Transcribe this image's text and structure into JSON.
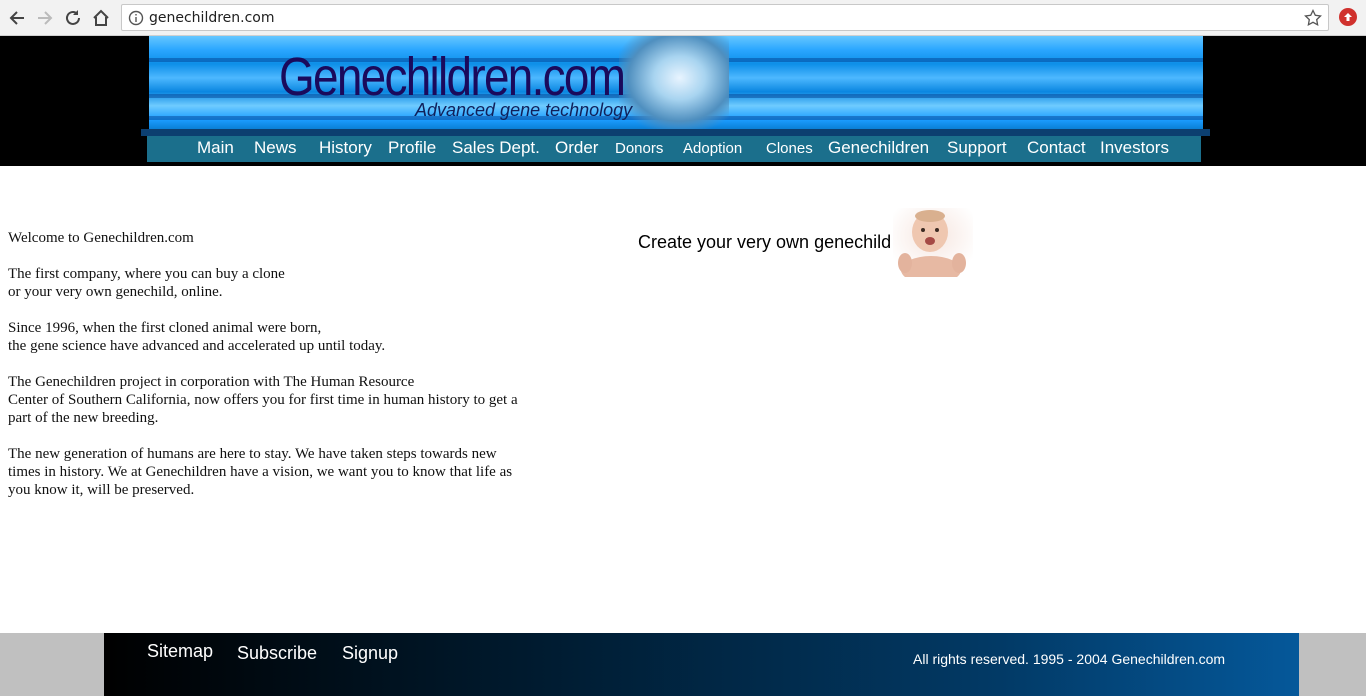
{
  "browser": {
    "url": "genechildren.com"
  },
  "header": {
    "title": "Genechildren.com",
    "subtitle": "Advanced gene technology"
  },
  "nav": {
    "items": [
      {
        "label": "Main"
      },
      {
        "label": "News"
      },
      {
        "label": "History"
      },
      {
        "label": "Profile"
      },
      {
        "label": "Sales Dept."
      },
      {
        "label": "Order"
      },
      {
        "label": "Donors"
      },
      {
        "label": "Adoption"
      },
      {
        "label": "Clones"
      },
      {
        "label": "Genechildren"
      },
      {
        "label": "Support"
      },
      {
        "label": "Contact"
      },
      {
        "label": "Investors"
      }
    ]
  },
  "main": {
    "paragraphs": [
      "Welcome to Genechildren.com",
      "The first company, where you can buy a clone\nor your very own genechild, online.",
      "Since 1996, when the first cloned animal were born,\nthe gene science have advanced and accelerated up until today.",
      "The Genechildren project in corporation with The Human Resource\nCenter of Southern California, now offers you for first time in human history to get a\npart of the new breeding.",
      "The new generation of humans are here to stay. We have taken steps towards new\ntimes in history. We at Genechildren have a vision, we want you to know that life as\nyou know it, will be preserved."
    ]
  },
  "promo": {
    "text": "Create your very own genechild"
  },
  "footer": {
    "links": [
      {
        "label": "Sitemap"
      },
      {
        "label": "Subscribe"
      },
      {
        "label": "Signup"
      }
    ],
    "copyright": "All rights reserved. 1995 - 2004 Genechildren.com"
  },
  "colors": {
    "header_bg": "#000000",
    "banner_blue": "#1b9cff",
    "nav_bar": "#1b6f8c",
    "title_text": "#1a0a5c",
    "footer_end": "#05589a"
  }
}
